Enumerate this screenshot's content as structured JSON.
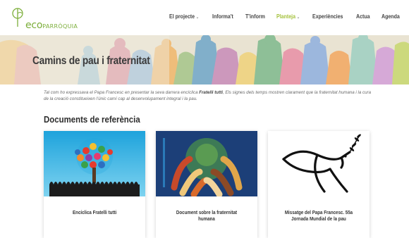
{
  "header": {
    "logo": {
      "eco": "eco",
      "parroquia": "PARRÒQUIA"
    },
    "nav": [
      {
        "label": "El projecte",
        "caret": true,
        "active": false
      },
      {
        "label": "Informa't",
        "caret": false,
        "active": false
      },
      {
        "label": "T'inform",
        "caret": false,
        "active": false
      },
      {
        "label": "Planteja",
        "caret": true,
        "active": true
      },
      {
        "label": "Experiències",
        "caret": false,
        "active": false
      },
      {
        "label": "Actua",
        "caret": false,
        "active": false
      },
      {
        "label": "Agenda",
        "caret": false,
        "active": false
      }
    ]
  },
  "banner": {
    "title": "Camins de pau i fraternitat"
  },
  "intro": {
    "before": "Tal com ho expressava el Papa Francesc en presentar la seva darrera encíclica ",
    "bold": "Fratelli tutti",
    "after": ", Els signes dels temps mostren clarament que la fraternitat humana i la cura de la creació constitueixen l'únic camí cap al desenvolupament integral i la pau."
  },
  "section": {
    "title": "Documents de referència"
  },
  "cards": [
    {
      "title": "Encíclica Fratelli tutti"
    },
    {
      "title": "Document sobre la fraternitat humana"
    },
    {
      "title": "Missatge del Papa Francesc. 55a Jornada Mundial de la pau"
    }
  ],
  "colors": {
    "accent": "#a4c13b",
    "logo_green": "#7cae3a"
  }
}
